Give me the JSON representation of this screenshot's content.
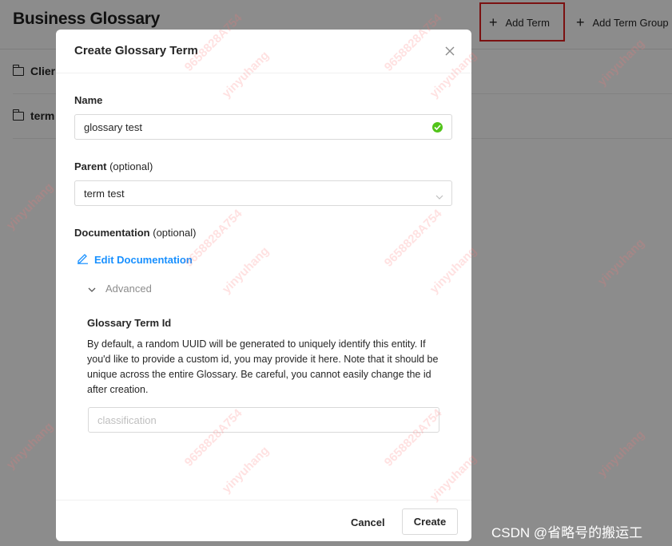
{
  "page": {
    "title": "Business Glossary",
    "add_term_label": "Add Term",
    "add_term_group_label": "Add Term Group",
    "items": [
      {
        "label": "Clier"
      },
      {
        "label": "term"
      }
    ]
  },
  "modal": {
    "title": "Create Glossary Term",
    "name_label": "Name",
    "name_value": "glossary test",
    "parent_label": "Parent",
    "parent_optional": "(optional)",
    "parent_value": "term test",
    "documentation_label": "Documentation",
    "documentation_optional": "(optional)",
    "edit_documentation_label": "Edit Documentation",
    "advanced_label": "Advanced",
    "term_id_label": "Glossary Term Id",
    "term_id_description": "By default, a random UUID will be generated to uniquely identify this entity. If you'd like to provide a custom id, you may provide it here. Note that it should be unique across the entire Glossary. Be careful, you cannot easily change the id after creation.",
    "term_id_placeholder": "classification",
    "cancel_label": "Cancel",
    "create_label": "Create"
  },
  "watermark": {
    "text_a": "9658828A754",
    "text_b": "yinyuhang"
  },
  "credit": "CSDN @省略号的搬运工",
  "colors": {
    "accent": "#1890ff",
    "success": "#52c41a",
    "highlight": "#e11f1f"
  }
}
